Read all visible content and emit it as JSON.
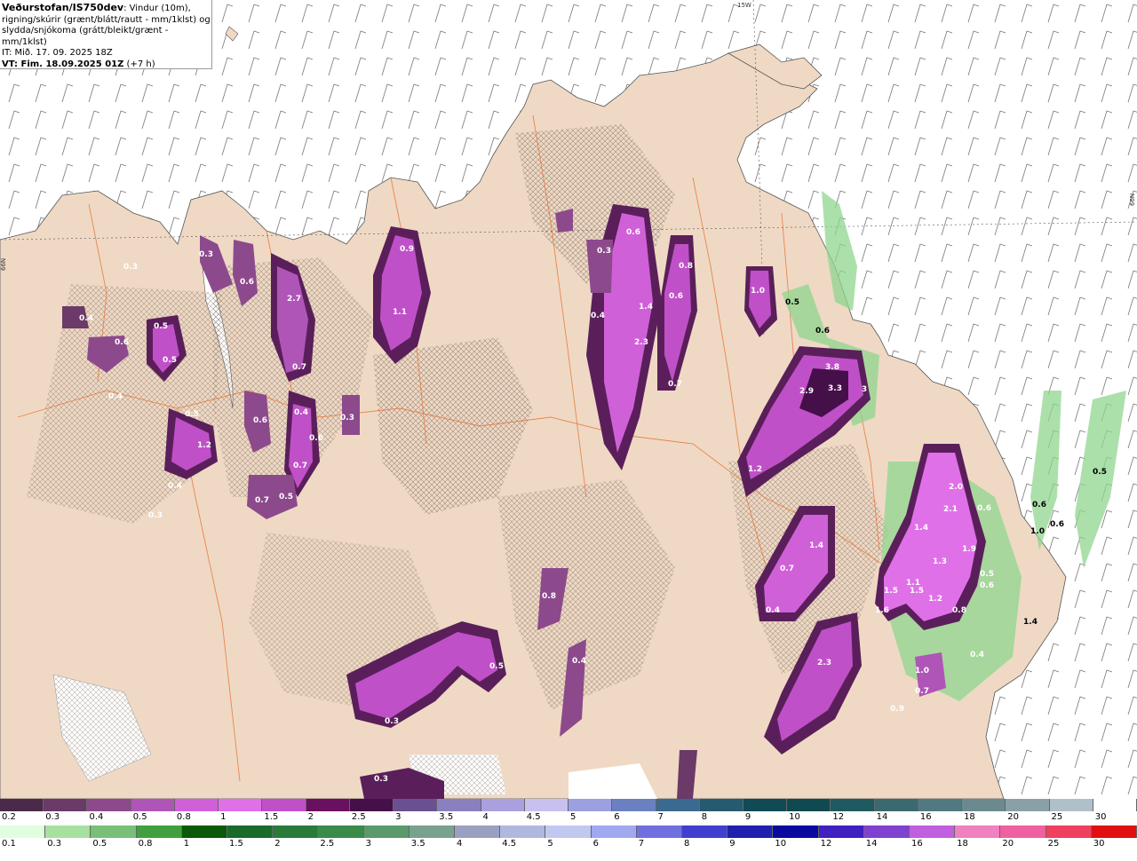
{
  "header": {
    "title": "Veðurstofan/IS750dev",
    "title_rest": ": Vindur (10m),",
    "line2": "rigning/skúrir (grænt/blátt/rautt - mm/1klst) og",
    "line3": "slydda/snjókoma (grátt/bleikt/grænt - mm/1klst)",
    "line4": "IT: Mið. 17. 09. 2025 18Z",
    "line5_bold": "VT: Fim. 18.09.2025 01Z",
    "line5_rest": " (+7 h)"
  },
  "grid_labels": {
    "lon_15w": "15W",
    "lat_66n_left": "66N",
    "lat_66n_right": "66N"
  },
  "colors": {
    "land": "#efd9c4",
    "sea": "#ffffff",
    "precip_purple": "#c040d0",
    "precip_dark": "#5a1f5a",
    "precip_green": "#8fd68f",
    "roads": "#e8763a"
  },
  "precip_labels": [
    "0.3",
    "0.4",
    "0.6",
    "0.5",
    "0.5",
    "0.4",
    "1.2",
    "0.4",
    "0.5",
    "0.3",
    "2.7",
    "0.6",
    "0.7",
    "0.3",
    "0.6",
    "0.4",
    "0.6",
    "0.7",
    "0.7",
    "0.5",
    "1.1",
    "0.9",
    "0.3",
    "0.4",
    "0.3",
    "0.6",
    "1.4",
    "2.3",
    "0.8",
    "0.7",
    "0.6",
    "1.0",
    "0.5",
    "0.6",
    "3.8",
    "3.3",
    "2.9",
    "3",
    "1.2",
    "1.4",
    "0.4",
    "0.7",
    "2.3",
    "1.5",
    "1.4",
    "1.3",
    "2.1",
    "2.0",
    "1.9",
    "1.6",
    "1.1",
    "1.5",
    "1.2",
    "0.8",
    "0.9",
    "1.0",
    "0.7",
    "0.4",
    "0.6",
    "0.5",
    "1.4",
    "0.3",
    "0.3",
    "0.5",
    "0.4",
    "0.8",
    "0.6",
    "1.0",
    "0.6",
    "0.6",
    "0.5"
  ],
  "legend_snow": {
    "ticks": [
      "0.2",
      "0.3",
      "0.4",
      "0.5",
      "0.8",
      "1",
      "1.5",
      "2",
      "2.5",
      "3",
      "3.5",
      "4",
      "4.5",
      "5",
      "6",
      "7",
      "8",
      "9",
      "10",
      "12",
      "14",
      "16",
      "18",
      "20",
      "25",
      "30"
    ],
    "colors": [
      "#4a2a48",
      "#6b3a68",
      "#8c4a8c",
      "#b055b8",
      "#d060d8",
      "#e070e8",
      "#c050c8",
      "#6a1060",
      "#45104a",
      "#6a5090",
      "#8a80c0",
      "#aaa0e0",
      "#c8c0f0",
      "#9aa0e0",
      "#6a80c0",
      "#3a6a90",
      "#255a70",
      "#104a55",
      "#104a50",
      "#205a60",
      "#3a6a70",
      "#507a80",
      "#6a8a90",
      "#8aa0a8",
      "#b0c0c8",
      "#ffffff"
    ]
  },
  "legend_rain": {
    "ticks": [
      "0.1",
      "0.3",
      "0.5",
      "0.8",
      "1",
      "1.5",
      "2",
      "2.5",
      "3",
      "3.5",
      "4",
      "4.5",
      "5",
      "6",
      "7",
      "8",
      "9",
      "10",
      "12",
      "14",
      "16",
      "18",
      "20",
      "25",
      "30"
    ],
    "colors": [
      "#e0ffe0",
      "#a8e0a0",
      "#78c078",
      "#40a040",
      "#0a5a0a",
      "#1a6a2a",
      "#2a7a3a",
      "#3a8a4a",
      "#5a9a6a",
      "#7aa090",
      "#9aa0c0",
      "#b0b8e0",
      "#c0c8f0",
      "#a0a8f0",
      "#7070e0",
      "#4040d0",
      "#2020b0",
      "#0a0aa0",
      "#4020c0",
      "#8040d0",
      "#c060e0",
      "#f080c0",
      "#f060a0",
      "#f04060",
      "#e01010"
    ]
  }
}
